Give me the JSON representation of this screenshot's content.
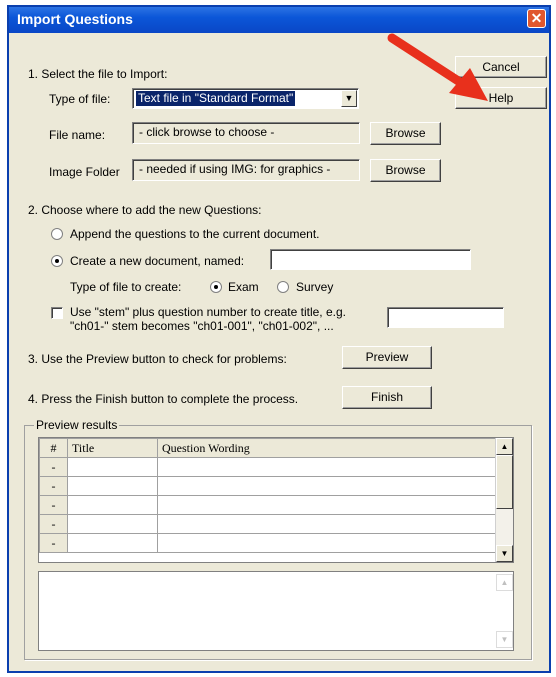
{
  "window": {
    "title": "Import Questions",
    "close_glyph": "✕"
  },
  "buttons": {
    "cancel": "Cancel",
    "help": "Help",
    "browse_file": "Browse",
    "browse_image": "Browse",
    "preview": "Preview",
    "finish": "Finish"
  },
  "step1": {
    "heading": "1. Select the file to Import:",
    "type_label": "Type of file:",
    "type_value": "Text file in \"Standard Format\"",
    "file_label": "File name:",
    "file_value": "- click browse to choose -",
    "image_label": "Image Folder",
    "image_value": "- needed if using IMG: for graphics -"
  },
  "step2": {
    "heading": "2. Choose where to add the new Questions:",
    "append_label": "Append the questions to the current document.",
    "create_label": "Create a new document, named:",
    "create_value": "",
    "filetype_label": "Type of file to create:",
    "exam_label": "Exam",
    "survey_label": "Survey",
    "stem_line1": "Use \"stem\" plus question number to create title,  e.g.",
    "stem_line2": "\"ch01-\" stem becomes \"ch01-001\",  \"ch01-002\",  ...",
    "stem_value": ""
  },
  "step3": {
    "text": "3. Use the Preview button to check for problems:"
  },
  "step4": {
    "text": "4. Press the Finish button to complete the process."
  },
  "preview": {
    "group_label": "Preview results",
    "columns": [
      "#",
      "Title",
      "Question Wording"
    ],
    "rows": [
      [
        "-",
        "",
        ""
      ],
      [
        "-",
        "",
        ""
      ],
      [
        "-",
        "",
        ""
      ],
      [
        "-",
        "",
        ""
      ],
      [
        "-",
        "",
        ""
      ]
    ]
  },
  "colors": {
    "titlebar": "#0b56d8",
    "dialog_bg": "#ece9d8",
    "selection": "#0a246a",
    "annotation_arrow": "#e8301c"
  },
  "icons": {
    "dropdown": "dropdown-arrow-icon",
    "scroll_up": "scroll-up-icon",
    "scroll_down": "scroll-down-icon",
    "close": "close-icon"
  }
}
